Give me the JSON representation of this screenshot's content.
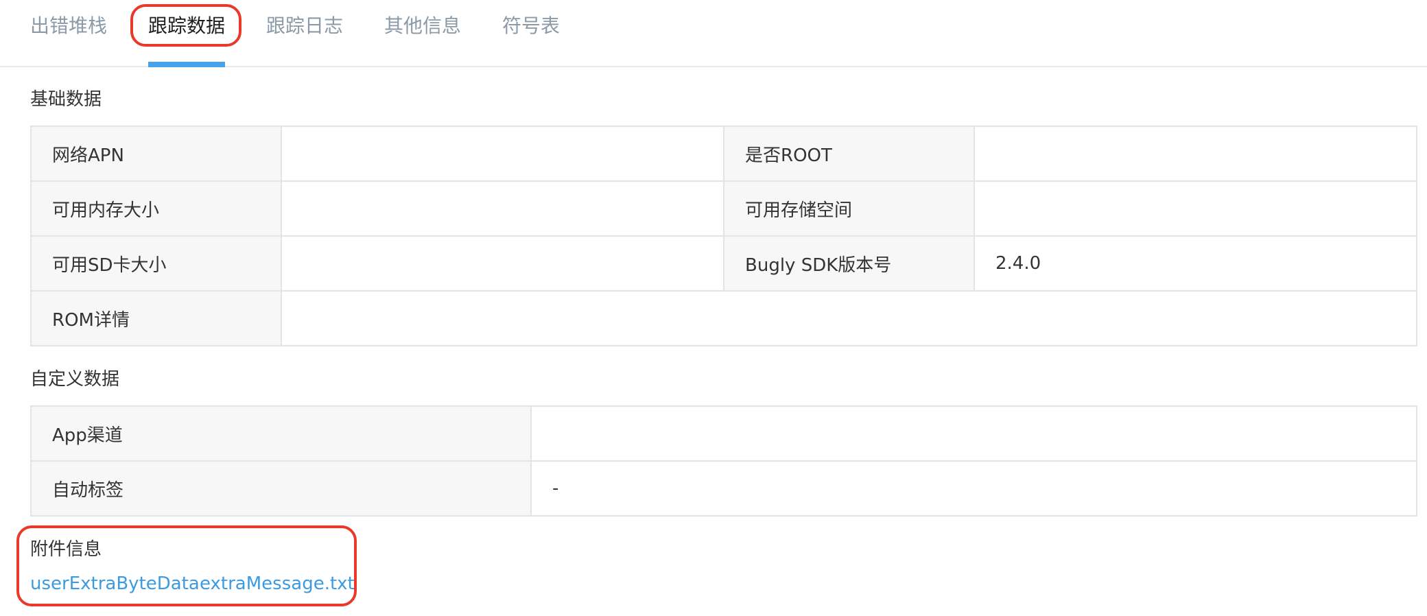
{
  "tabs": [
    {
      "label": "出错堆栈",
      "active": false
    },
    {
      "label": "跟踪数据",
      "active": true
    },
    {
      "label": "跟踪日志",
      "active": false
    },
    {
      "label": "其他信息",
      "active": false
    },
    {
      "label": "符号表",
      "active": false
    }
  ],
  "basic_data": {
    "title": "基础数据",
    "rows": [
      [
        {
          "key": "网络APN",
          "value": ""
        },
        {
          "key": "是否ROOT",
          "value": ""
        }
      ],
      [
        {
          "key": "可用内存大小",
          "value": ""
        },
        {
          "key": "可用存储空间",
          "value": ""
        }
      ],
      [
        {
          "key": "可用SD卡大小",
          "value": ""
        },
        {
          "key": "Bugly SDK版本号",
          "value": "2.4.0"
        }
      ]
    ],
    "rom": {
      "key": "ROM详情",
      "value": ""
    }
  },
  "custom_data": {
    "title": "自定义数据",
    "rows": [
      {
        "key": "App渠道",
        "value": ""
      },
      {
        "key": "自动标签",
        "value": "-"
      }
    ]
  },
  "attachments": {
    "title": "附件信息",
    "files": [
      "userExtraByteData",
      "extraMessage.txt"
    ]
  },
  "colors": {
    "accent": "#4aa3e8",
    "highlight": "#e8392b",
    "link": "#3a9be3"
  }
}
